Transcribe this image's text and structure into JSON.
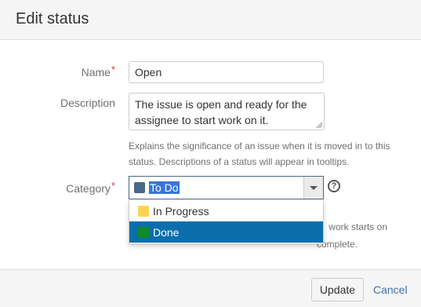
{
  "dialog": {
    "title": "Edit status"
  },
  "form": {
    "name": {
      "label": "Name",
      "value": "Open"
    },
    "description": {
      "label": "Description",
      "value_lines": [
        "The issue is open and ready for the",
        "assignee to start work on it."
      ],
      "help_lines": [
        "Explains the significance of an issue when it is moved in to this",
        "status. Descriptions of a status will appear in tooltips."
      ]
    },
    "category": {
      "label": "Category",
      "selected": {
        "label": "To Do",
        "color": "#4a6785"
      },
      "options": [
        {
          "label": "In Progress",
          "color": "#ffd351"
        },
        {
          "label": "Done",
          "color": "#14892c"
        }
      ],
      "help_partial": [
        "work starts on",
        "complete."
      ]
    },
    "required_marker": "*"
  },
  "footer": {
    "update_label": "Update",
    "cancel_label": "Cancel"
  },
  "icons": {
    "help": "question-circle-icon",
    "dropdown": "chevron-down-icon"
  },
  "colors": {
    "highlight": "#0a6fab",
    "link": "#3b73af",
    "required": "#d04437"
  }
}
